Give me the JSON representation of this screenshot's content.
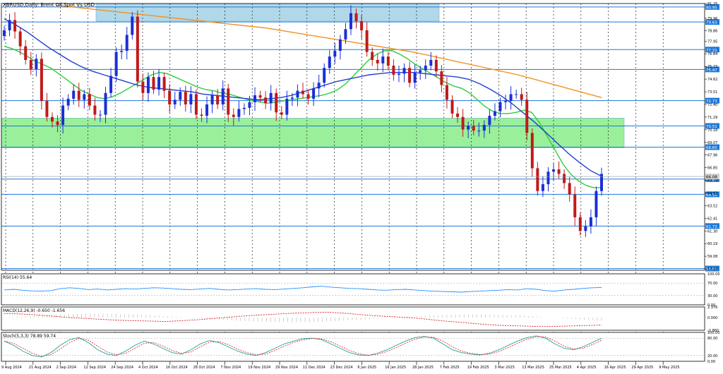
{
  "chart_data": {
    "type": "candlestick",
    "title": "XBRUSD,Daily: Brent Oil Spot Vs USD",
    "dates": [
      "9 Aug 2024",
      "21 Aug 2024",
      "2 Sep 2024",
      "12 Sep 2024",
      "24 Sep 2024",
      "4 Oct 2024",
      "16 Oct 2024",
      "28 Oct 2024",
      "7 Nov 2024",
      "19 Nov 2024",
      "29 Nov 2024",
      "11 Dec 2024",
      "23 Dec 2024",
      "6 Jan 2025",
      "16 Jan 2025",
      "28 Jan 2025",
      "7 Feb 2025",
      "19 Feb 2025",
      "3 Mar 2025",
      "13 Mar 2025",
      "25 Mar 2025",
      "4 Apr 2025",
      "16 Apr 2025",
      "29 Apr 2025",
      "9 May 2025"
    ],
    "main_axis": {
      "ylim": [
        57.85,
        81.25
      ],
      "ticks": [
        "81.25",
        "79.96",
        "78.86",
        "77.95",
        "76.84",
        "75.73",
        "74.62",
        "73.51",
        "72.40",
        "71.29",
        "70.18",
        "69.07",
        "67.96",
        "66.85",
        "65.74",
        "64.63",
        "63.52",
        "62.41",
        "61.30",
        "60.19",
        "59.08",
        "57.97"
      ],
      "current_price": "66.08"
    },
    "horizontal_levels": [
      "80.95",
      "79.63",
      "77.21",
      "75.47",
      "72.73",
      "70.51",
      "68.65",
      "65.85",
      "64.51",
      "61.73",
      "58.00"
    ],
    "zones": [
      {
        "name": "resistance-zone",
        "color": "#a8d4e6",
        "price_low": 79.7,
        "price_high": 81.25
      },
      {
        "name": "support-zone",
        "color": "#90ee90",
        "price_low": 68.6,
        "price_high": 71.2
      }
    ],
    "close_series": [
      78.9,
      79.8,
      78.8,
      77.5,
      76.3,
      75.5,
      76.4,
      72.7,
      71.3,
      70.9,
      70.6,
      72.3,
      72.9,
      73.6,
      72.8,
      73.3,
      72.3,
      71.5,
      71.5,
      73.4,
      74.9,
      77.0,
      77.1,
      78.5,
      80.1,
      74.4,
      73.4,
      74.8,
      73.7,
      74.8,
      73.6,
      72.4,
      72.8,
      73.5,
      72.4,
      73.3,
      71.5,
      71.4,
      72.4,
      73.2,
      72.4,
      73.8,
      71.5,
      71.3,
      72.0,
      72.1,
      72.6,
      73.2,
      73.0,
      72.5,
      73.4,
      71.7,
      71.5,
      72.9,
      73.0,
      73.6,
      73.3,
      72.9,
      73.8,
      74.3,
      75.6,
      76.6,
      77.1,
      78.1,
      79.0,
      80.4,
      79.7,
      78.9,
      77.0,
      76.3,
      76.0,
      76.6,
      75.8,
      75.0,
      75.1,
      75.6,
      74.3,
      75.2,
      75.4,
      75.8,
      76.3,
      75.3,
      74.1,
      72.8,
      71.6,
      71.3,
      70.2,
      70.5,
      70.1,
      70.1,
      70.6,
      71.4,
      71.8,
      72.6,
      72.7,
      73.3,
      73.3,
      72.8,
      69.9,
      66.8,
      64.8,
      65.4,
      66.5,
      66.7,
      66.3,
      65.5,
      64.5,
      62.5,
      61.3,
      61.7,
      62.5,
      64.8,
      66.3
    ],
    "ma_series": [
      {
        "name": "green-ma",
        "color": "#2ecc40",
        "values": [
          77.5,
          77.3,
          77.0,
          76.6,
          76.2,
          75.9,
          75.6,
          75.1,
          74.6,
          74.1,
          73.6,
          73.3,
          73.0,
          72.9,
          73.1,
          73.4,
          73.8,
          74.2,
          74.6,
          75.0,
          75.2,
          75.1,
          74.8,
          74.5,
          74.2,
          73.9,
          73.7,
          73.6,
          73.4,
          73.3,
          73.1,
          72.9,
          72.7,
          72.6,
          72.5,
          72.6,
          72.7,
          72.8,
          72.9,
          73.0,
          73.1,
          73.2,
          73.4,
          73.7,
          74.2,
          74.9,
          75.6,
          76.3,
          76.8,
          77.1,
          77.1,
          76.8,
          76.4,
          75.9,
          75.5,
          75.1,
          74.7,
          74.3,
          74.0,
          73.8,
          73.4,
          72.8,
          72.2,
          71.8,
          71.6,
          71.6,
          71.7,
          71.9,
          71.7,
          70.8,
          69.6,
          68.4,
          67.2,
          66.3,
          65.7,
          65.3,
          65.1,
          65.1
        ]
      },
      {
        "name": "blue-ma",
        "color": "#1f3fd1",
        "values": [
          79.9,
          79.4,
          78.8,
          78.1,
          77.4,
          76.8,
          76.2,
          75.7,
          75.3,
          75.0,
          74.7,
          74.4,
          74.1,
          73.9,
          73.8,
          73.7,
          73.6,
          73.5,
          73.3,
          73.2,
          73.1,
          73.0,
          72.9,
          72.8,
          72.9,
          73.0,
          73.2,
          73.5,
          73.8,
          74.1,
          74.4,
          74.6,
          74.8,
          75.0,
          75.1,
          75.2,
          75.2,
          75.2,
          75.1,
          75.0,
          74.9,
          74.8,
          74.6,
          74.2,
          73.7,
          73.1,
          72.4,
          71.6,
          70.8,
          69.9,
          69.0,
          68.1,
          67.3,
          66.6,
          66.1
        ]
      },
      {
        "name": "orange-ma",
        "color": "#f29120",
        "values": [
          81.1,
          80.9,
          80.7,
          80.5,
          80.3,
          80.1,
          79.9,
          79.7,
          79.5,
          79.3,
          79.1,
          78.8,
          78.5,
          78.2,
          77.9,
          77.6,
          77.3,
          77.0,
          76.6,
          76.2,
          75.8,
          75.4,
          75.0,
          74.5,
          74.0,
          73.5,
          73.0
        ]
      }
    ],
    "rsi": {
      "label": "RSI(14) 55.64",
      "ticks": [
        "100.00",
        "70.00",
        "30.00",
        "0.00"
      ],
      "values": [
        48,
        50,
        47,
        45,
        44,
        46,
        52,
        55,
        53,
        49,
        51,
        48,
        50,
        52,
        51,
        53,
        55,
        54,
        52,
        50,
        49,
        51,
        53,
        50,
        48,
        49,
        51,
        52,
        50,
        49,
        51,
        53,
        55,
        58,
        60,
        57,
        55,
        53,
        52,
        50,
        48,
        47,
        49,
        50,
        48,
        46,
        44,
        43,
        42,
        41,
        43,
        44,
        46,
        47,
        49,
        48,
        52,
        50,
        46,
        44,
        48,
        50,
        53,
        55,
        56
      ]
    },
    "macd": {
      "label": "MACD(12,26,9) -0.650 -1.656",
      "ticks": [
        "2.376",
        "0.000",
        "-2.860"
      ],
      "values": [
        0.9,
        0.8,
        0.6,
        0.3,
        0.0,
        -0.2,
        -0.4,
        -0.6,
        -0.7,
        -0.8,
        -0.9,
        -0.7,
        -0.5,
        -0.2,
        0.1,
        0.4,
        0.6,
        0.8,
        1.0,
        1.1,
        1.2,
        1.0,
        0.7,
        0.4,
        0.2,
        0.0,
        -0.3,
        -0.7,
        -1.0,
        -1.3,
        -1.6,
        -1.8,
        -1.9,
        -2.0,
        -2.0,
        -1.9,
        -1.8,
        -1.7
      ]
    },
    "stoch": {
      "label": "Stoch(5,3,3) 78.89 59.74",
      "ticks": [
        "100.00",
        "80.00",
        "20.00",
        "0.00"
      ],
      "values": [
        70,
        55,
        35,
        20,
        15,
        30,
        55,
        75,
        82,
        65,
        40,
        25,
        20,
        35,
        55,
        70,
        60,
        45,
        30,
        25,
        40,
        60,
        72,
        65,
        50,
        35,
        25,
        20,
        30,
        45,
        60,
        70,
        78,
        80,
        75,
        60,
        45,
        30,
        22,
        20,
        28,
        40,
        55,
        70,
        82,
        86,
        80,
        60,
        40,
        30,
        25,
        22,
        28,
        40,
        55,
        70,
        82,
        88,
        80,
        60,
        45,
        40,
        50,
        65,
        80
      ]
    }
  }
}
